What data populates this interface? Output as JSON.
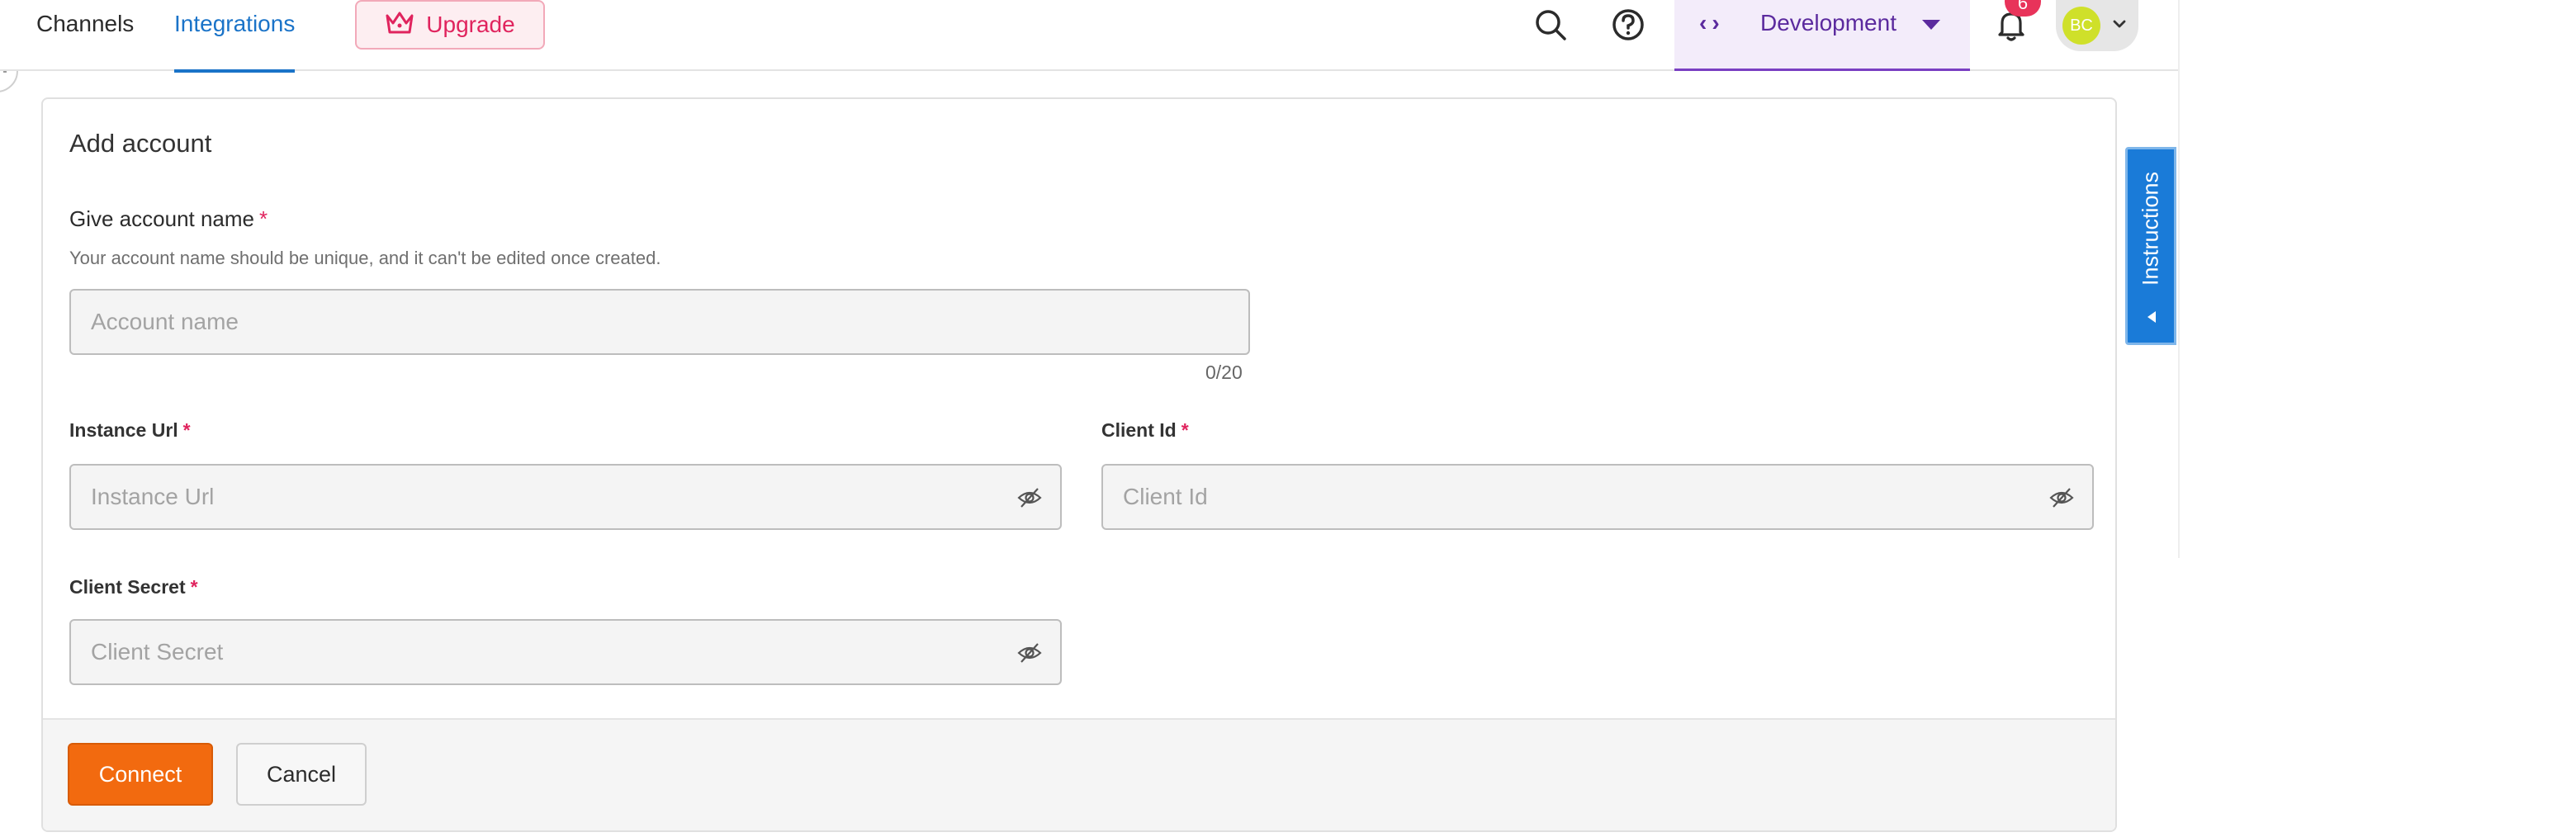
{
  "nav": {
    "tabs": [
      {
        "label": "Channels",
        "active": false
      },
      {
        "label": "Integrations",
        "active": true
      }
    ],
    "upgrade_label": "Upgrade",
    "environment": "Development",
    "notification_count": "6",
    "user_initials": "BC"
  },
  "form": {
    "title": "Add account",
    "account_name": {
      "label": "Give account name",
      "required": "*",
      "hint": "Your account name should be unique, and it can't be edited once created.",
      "placeholder": "Account name",
      "value": "",
      "counter": "0/20"
    },
    "instance_url": {
      "label": "Instance Url",
      "required": "*",
      "placeholder": "Instance Url",
      "value": ""
    },
    "client_id": {
      "label": "Client Id",
      "required": "*",
      "placeholder": "Client Id",
      "value": ""
    },
    "client_secret": {
      "label": "Client Secret",
      "required": "*",
      "placeholder": "Client Secret",
      "value": ""
    },
    "connect_label": "Connect",
    "cancel_label": "Cancel"
  },
  "instructions_label": "Instructions",
  "colors": {
    "accent": "#1a73c8",
    "upgrade": "#e0245e",
    "environment": "#5b2a9e",
    "connect": "#f26a0f",
    "instructions": "#1a7bd8"
  },
  "icons": {
    "search": "search-icon",
    "help": "help-circle-icon",
    "bell": "bell-icon",
    "crown": "crown-icon",
    "eye": "eye-off-icon",
    "code": "code-icon"
  }
}
